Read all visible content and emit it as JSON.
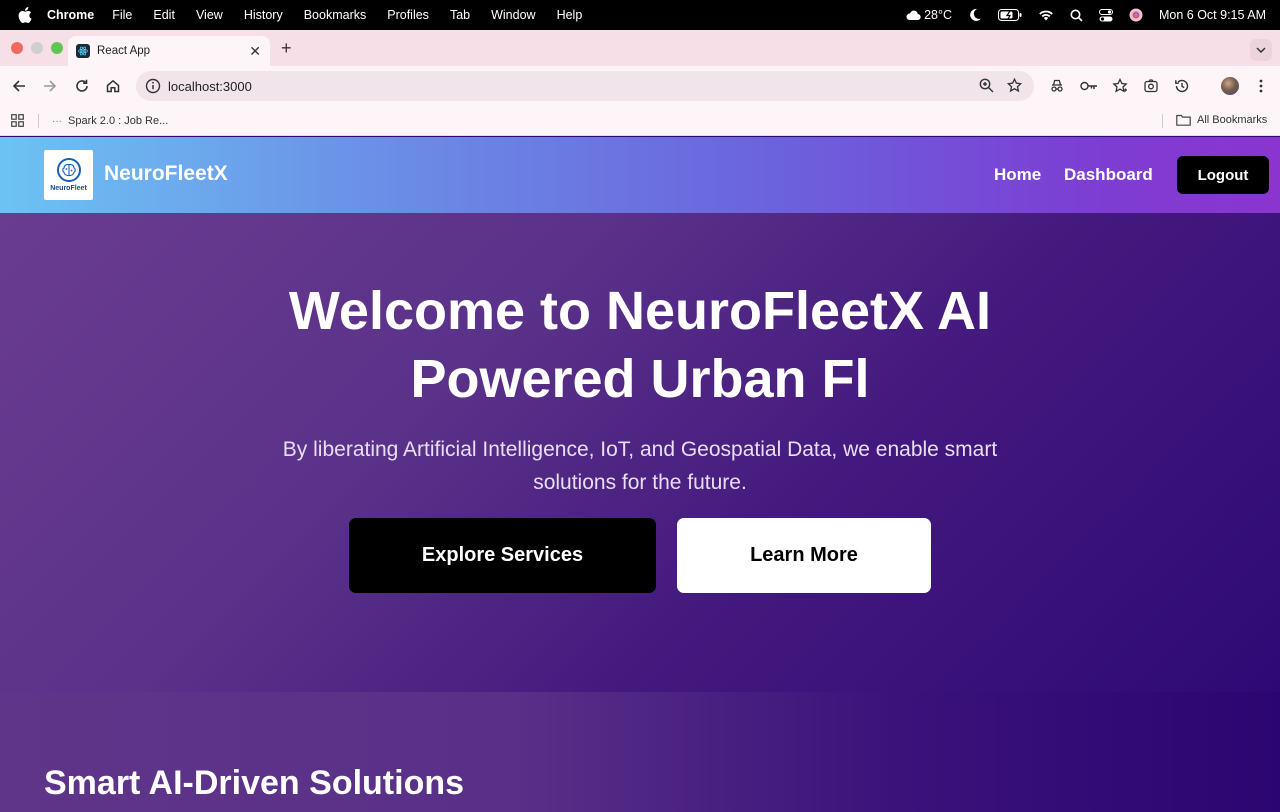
{
  "menubar": {
    "app": "Chrome",
    "items": [
      "File",
      "Edit",
      "View",
      "History",
      "Bookmarks",
      "Profiles",
      "Tab",
      "Window",
      "Help"
    ],
    "weather": "28°C",
    "datetime": "Mon 6 Oct  9:15 AM"
  },
  "browser": {
    "tab_title": "React App",
    "url": "localhost:3000",
    "bookmarks": [
      {
        "label": "Spark 2.0 : Job Re..."
      }
    ],
    "all_bookmarks": "All Bookmarks"
  },
  "site": {
    "logo_text": "NeuroFleet",
    "brand": "NeuroFleetX",
    "nav": {
      "home": "Home",
      "dashboard": "Dashboard",
      "logout": "Logout"
    },
    "hero": {
      "title_line1": "Welcome to NeuroFleetX AI",
      "title_line2": "Powered Urban Fl",
      "subtitle_line1": "By liberating Artificial Intelligence, IoT, and Geospatial Data, we enable smart",
      "subtitle_line2": "solutions for the future.",
      "explore_label": "Explore Services",
      "learn_label": "Learn More"
    },
    "section2_title": "Smart AI-Driven Solutions"
  },
  "colors": {
    "traffic_red": "#ee6a5f",
    "traffic_yellow": "#cfcfcf",
    "traffic_green": "#61c554",
    "navbar_start": "#6cc3f3",
    "navbar_end": "#8a35cf",
    "hero_bg": "#5a3289"
  }
}
